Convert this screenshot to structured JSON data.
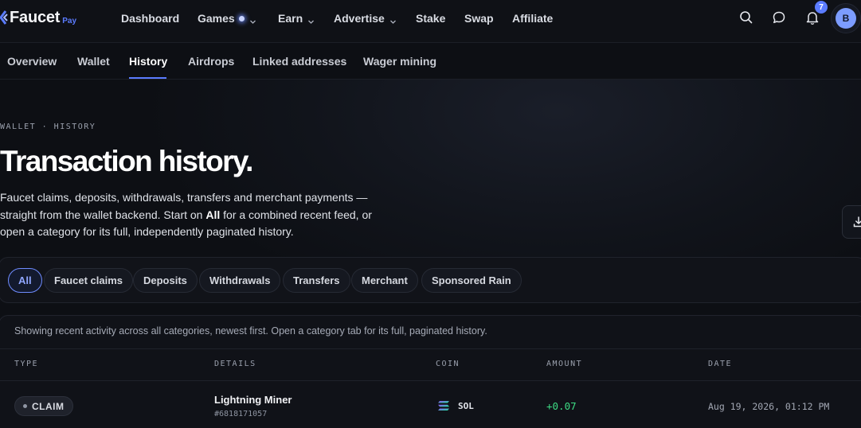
{
  "brand": {
    "name": "Faucet",
    "suffix": "Pay",
    "accent": "#5b7cff"
  },
  "nav": {
    "items": [
      {
        "label": "Dashboard"
      },
      {
        "label": "Games"
      },
      {
        "label": "Earn"
      },
      {
        "label": "Advertise"
      },
      {
        "label": "Stake"
      },
      {
        "label": "Swap"
      },
      {
        "label": "Affiliate"
      }
    ],
    "notifications_count": "7",
    "avatar_initial": "B",
    "icons": [
      "search-icon",
      "chat-icon",
      "bell-icon"
    ]
  },
  "subtabs": {
    "items": [
      {
        "label": "Overview"
      },
      {
        "label": "Wallet"
      },
      {
        "label": "History"
      },
      {
        "label": "Airdrops"
      },
      {
        "label": "Linked addresses"
      },
      {
        "label": "Wager mining"
      }
    ],
    "active": "History"
  },
  "hero": {
    "eyebrow": "WALLET · HISTORY",
    "title": "Transaction history.",
    "desc_part1": "Faucet claims, deposits, withdrawals, transfers and merchant payments — straight from the wallet backend. Start on ",
    "desc_bold": "All",
    "desc_part2": " for a combined recent feed, or open a category for its full, independently paginated history."
  },
  "filters": {
    "chips": [
      {
        "label": "All"
      },
      {
        "label": "Faucet claims"
      },
      {
        "label": "Deposits"
      },
      {
        "label": "Withdrawals"
      },
      {
        "label": "Transfers"
      },
      {
        "label": "Merchant"
      },
      {
        "label": "Sponsored Rain"
      }
    ],
    "active": "All"
  },
  "table": {
    "notice": "Showing recent activity across all categories, newest first. Open a category tab for its full, paginated history.",
    "columns": [
      "TYPE",
      "DETAILS",
      "COIN",
      "AMOUNT",
      "DATE"
    ],
    "rows": [
      {
        "type": "CLAIM",
        "title": "Lightning Miner",
        "id": "#6818171057",
        "coin": "SOL",
        "amount": "+0.07",
        "date": "Aug 19, 2026, 01:12 PM"
      }
    ],
    "colors": {
      "positive": "#3ddc84"
    }
  }
}
